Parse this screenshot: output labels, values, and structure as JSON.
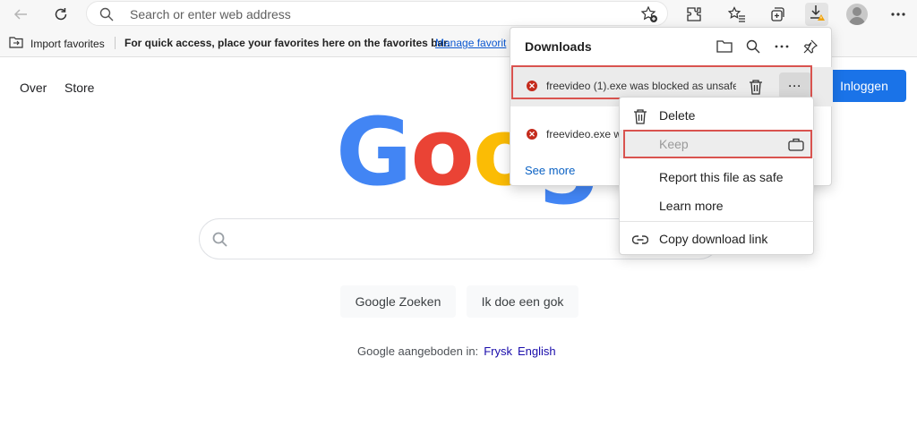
{
  "browser": {
    "address_placeholder": "Search or enter web address",
    "favbar": {
      "import_label": "Import favorites",
      "hint": "For quick access, place your favorites here on the favorites bar.",
      "manage_link": "Manage favorit"
    }
  },
  "page": {
    "nav": [
      "Over",
      "Store"
    ],
    "signin": "Inloggen",
    "logo_letters": [
      {
        "ch": "G",
        "color": "#4285F4"
      },
      {
        "ch": "o",
        "color": "#EA4335"
      },
      {
        "ch": "o",
        "color": "#FBBC05"
      },
      {
        "ch": "g",
        "color": "#4285F4"
      }
    ],
    "buttons": [
      "Google Zoeken",
      "Ik doe een gok"
    ],
    "offered_in": "Google aangeboden in:",
    "languages": [
      "Frysk",
      "English"
    ]
  },
  "downloads": {
    "title": "Downloads",
    "items": [
      {
        "name": "freevideo (1).exe was blocked as unsafe"
      },
      {
        "name": "freevideo.exe w"
      }
    ],
    "see_more": "See more"
  },
  "context_menu": {
    "items": [
      {
        "label": "Delete",
        "icon": "trash-icon",
        "enabled": true
      },
      {
        "label": "Keep",
        "icon": "briefcase-icon",
        "enabled": false
      },
      {
        "label": "Report this file as safe",
        "icon": "",
        "enabled": true
      },
      {
        "label": "Learn more",
        "icon": "",
        "enabled": true
      },
      {
        "label": "Copy download link",
        "icon": "link-icon",
        "enabled": true
      }
    ]
  },
  "colors": {
    "accent": "#1a73e8",
    "error": "#c42b1c",
    "highlight": "#d9534f",
    "link": "#0b62c4"
  }
}
